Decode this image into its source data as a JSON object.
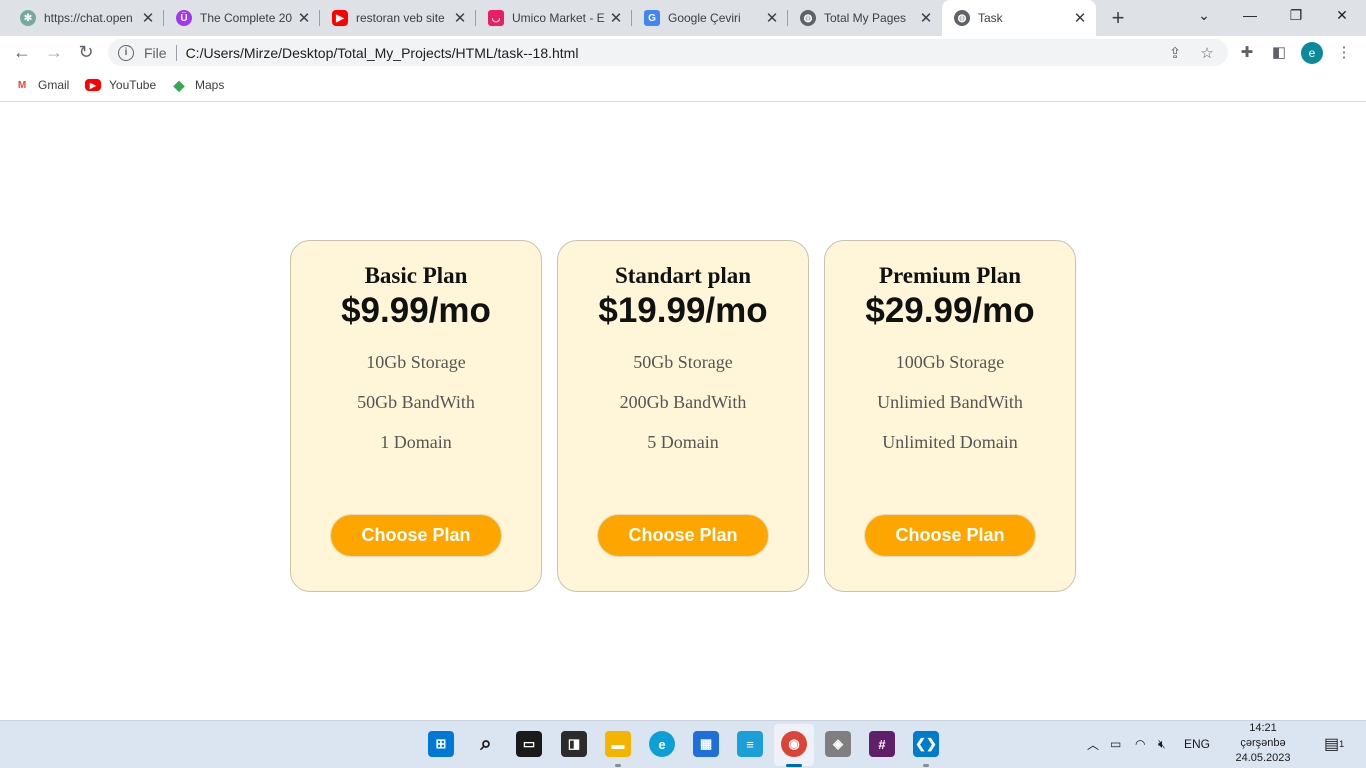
{
  "browser": {
    "tabs": [
      {
        "title": "https://chat.open",
        "icon": "chatgpt-icon",
        "color": "#74aa9c"
      },
      {
        "title": "The Complete 20",
        "icon": "udemy-icon",
        "color": "#a435f0"
      },
      {
        "title": "restoran veb site",
        "icon": "youtube-icon",
        "color": "#ff0000"
      },
      {
        "title": "Umico Market - E",
        "icon": "umico-icon",
        "color": "#e91e63"
      },
      {
        "title": "Google Çeviri",
        "icon": "google-translate-icon",
        "color": "#4285f4"
      },
      {
        "title": "Total My Pages",
        "icon": "globe-icon",
        "color": "#5f6368"
      },
      {
        "title": "Task",
        "icon": "globe-icon",
        "color": "#5f6368"
      }
    ],
    "address": {
      "scheme_label": "File",
      "url": "C:/Users/Mirze/Desktop/Total_My_Projects/HTML/task--18.html"
    },
    "profile_initial": "e",
    "bookmarks": [
      {
        "label": "Gmail",
        "icon": "gmail-icon"
      },
      {
        "label": "YouTube",
        "icon": "youtube-icon"
      },
      {
        "label": "Maps",
        "icon": "maps-icon"
      }
    ]
  },
  "plans": [
    {
      "name": "Basic Plan",
      "price": "$9.99/mo",
      "features": [
        "10Gb Storage",
        "50Gb BandWith",
        "1 Domain"
      ],
      "button": "Choose Plan"
    },
    {
      "name": "Standart plan",
      "price": "$19.99/mo",
      "features": [
        "50Gb Storage",
        "200Gb BandWith",
        "5 Domain"
      ],
      "button": "Choose Plan"
    },
    {
      "name": "Premium Plan",
      "price": "$29.99/mo",
      "features": [
        "100Gb Storage",
        "Unlimied BandWith",
        "Unlimited Domain"
      ],
      "button": "Choose Plan"
    }
  ],
  "colors": {
    "card_background": "#fff6da",
    "button_background": "#ffa500",
    "button_text": "#ffffff"
  },
  "taskbar": {
    "language": "ENG",
    "time": "14:21",
    "day": "çərşənbə",
    "date": "24.05.2023",
    "notification_count": "1"
  }
}
